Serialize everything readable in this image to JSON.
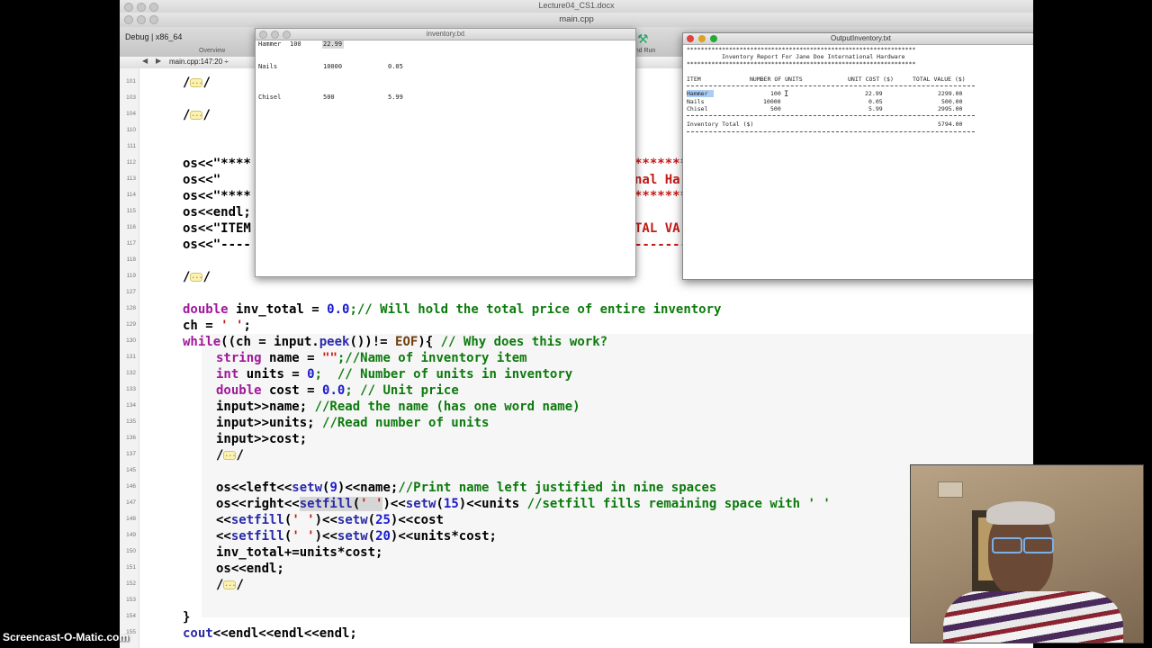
{
  "app": {
    "doc_title": "Lecture04_CS1.docx",
    "xcode_title": "main.cpp",
    "scheme": "Debug | x86_64",
    "overview": "Overview",
    "run_label": "d and Run",
    "jump_file": "main.cpp:147:20 ÷"
  },
  "line_numbers": [
    "101",
    "103",
    "104",
    "110",
    "111",
    "112",
    "113",
    "114",
    "115",
    "116",
    "117",
    "118",
    "119",
    "127",
    "128",
    "129",
    "130",
    "131",
    "132",
    "133",
    "134",
    "135",
    "136",
    "137",
    "145",
    "146",
    "147",
    "148",
    "149",
    "150",
    "151",
    "152",
    "153",
    "154",
    "155"
  ],
  "code": {
    "l101": "/",
    "l101b": "/",
    "l104": "/",
    "l104b": "/",
    "os_a": "os<<\"****",
    "os_b": "os<<\"",
    "os_c": "os<<\"****",
    "os_d": "os<<endl;",
    "os_e": "os<<\"ITEM",
    "os_f": "os<<\"----",
    "r1": "*******",
    "r2": "nal Ha",
    "r3": "*******",
    "r5": "TAL VA",
    "r6": "-------",
    "l119": "/",
    "l119b": "/",
    "l128_kw": "double",
    "l128_mid": " inv_total = ",
    "l128_num": "0.0",
    "l128_cm": ";// Will hold the total price of entire inventory",
    "l129_a": "ch = ",
    "l129_str": "' '",
    "l129_b": ";",
    "l130_kw": "while",
    "l130_a": "((ch = input.",
    "l130_fn": "peek",
    "l130_b": "())!= ",
    "l130_eof": "EOF",
    "l130_c": "){ ",
    "l130_cm": "// Why does this work?",
    "l131_kw": "string",
    "l131_a": " name = ",
    "l131_str": "\"\"",
    "l131_cm": ";//Name of inventory item",
    "l132_kw": "int",
    "l132_a": " units = ",
    "l132_num": "0",
    "l132_cm": ";  // Number of units in inventory",
    "l133_kw": "double",
    "l133_a": " cost = ",
    "l133_num": "0.0",
    "l133_cm": "; // Unit price",
    "l134_a": "input>>name; ",
    "l134_cm": "//Read the name (has one word name)",
    "l135_a": "input>>units; ",
    "l135_cm": "//Read number of units",
    "l136_a": "input>>cost;",
    "l137": "/",
    "l137b": "/",
    "l146_a": "os<<left<<",
    "l146_fn": "setw",
    "l146_b": "(",
    "l146_num": "9",
    "l146_c": ")<<name;",
    "l146_cm": "//Print name left justified in nine spaces",
    "l147_a": "os<<right<<",
    "l147_fn": "setfill",
    "l147_b": "(",
    "l147_str": "' '",
    "l147_c": ")<<",
    "l147_fn2": "setw",
    "l147_d": "(",
    "l147_num": "15",
    "l147_e": ")<<units ",
    "l147_cm": "//setfill fills remaining space with ' '",
    "l148_a": "<<",
    "l148_fn": "setfill",
    "l148_b": "(",
    "l148_str": "' '",
    "l148_c": ")<<",
    "l148_fn2": "setw",
    "l148_d": "(",
    "l148_num": "25",
    "l148_e": ")<<cost",
    "l149_a": "<<",
    "l149_fn": "setfill",
    "l149_b": "(",
    "l149_str": "' '",
    "l149_c": ")<<",
    "l149_fn2": "setw",
    "l149_d": "(",
    "l149_num": "20",
    "l149_e": ")<<units*cost;",
    "l150": "inv_total+=units*cost;",
    "l151": "os<<endl;",
    "l152": "/",
    "l152b": "/",
    "l154": "}",
    "l155_a": "cout",
    "l155_b": "<<endl<<endl<<endl;",
    "fold": "..."
  },
  "inventory_window": {
    "title": "inventory.txt",
    "rows": [
      {
        "name": "Hammer",
        "units": "100",
        "cost": "22.99"
      },
      {
        "name": "Nails",
        "units": "10000",
        "cost": "0.05"
      },
      {
        "name": "Chisel",
        "units": "500",
        "cost": "5.99"
      }
    ]
  },
  "output_window": {
    "title": "OutputInventory.txt",
    "stars": "*****************************************************************",
    "heading": "Inventory Report For Jane Doe International Hardware",
    "headers": {
      "item": "ITEM",
      "units": "NUMBER OF UNITS",
      "cost": "UNIT COST ($)",
      "value": "TOTAL VALUE ($)"
    },
    "rows": [
      {
        "item": "Hammer",
        "units": "100",
        "cost": "22.99",
        "value": "2299.00"
      },
      {
        "item": "Nails",
        "units": "10000",
        "cost": "0.05",
        "value": "500.00"
      },
      {
        "item": "Chisel",
        "units": "500",
        "cost": "5.99",
        "value": "2995.00"
      }
    ],
    "total_label": "Inventory Total ($)",
    "total_value": "5794.00"
  },
  "watermark": "Screencast-O-Matic.com",
  "colors": {
    "keyword": "#a0189a",
    "function": "#2a2aa8",
    "number": "#1a1acc",
    "comment": "#0d7a0d",
    "string": "#c41a16"
  }
}
